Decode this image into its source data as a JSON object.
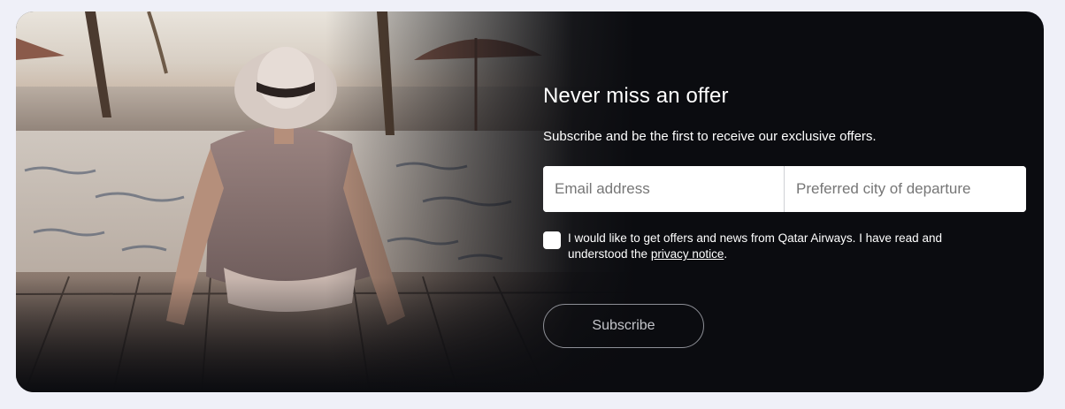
{
  "newsletter": {
    "title": "Never miss an offer",
    "subtitle": "Subscribe and be the first to receive our exclusive offers.",
    "email_placeholder": "Email address",
    "city_placeholder": "Preferred city of departure",
    "consent_prefix": "I would like to get offers and news from Qatar Airways. I have read and understood the ",
    "consent_link": "privacy notice",
    "consent_suffix": ".",
    "consent_checked": false,
    "subscribe_label": "Subscribe"
  },
  "colors": {
    "page_background": "#eff0f8",
    "card_background": "#0b0c10",
    "text": "#ffffff",
    "button_border": "#8d8f96"
  }
}
